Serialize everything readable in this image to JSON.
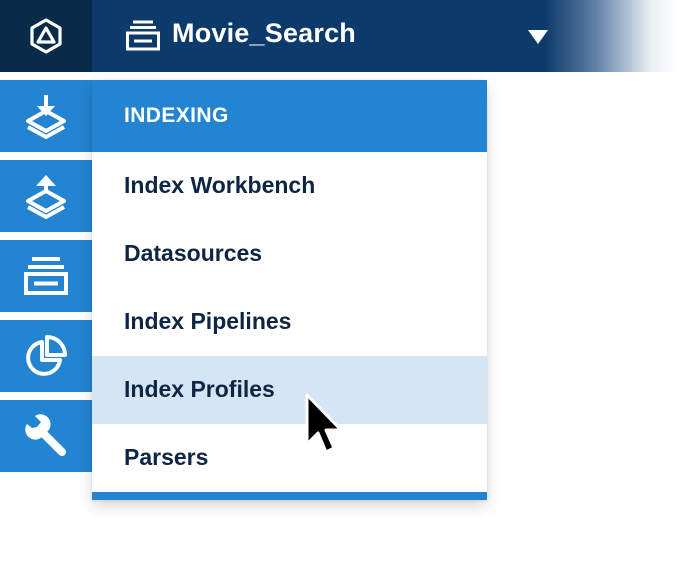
{
  "header": {
    "logo_icon": "fusion-logo-icon",
    "app_icon": "collection-stack-icon",
    "app_title": "Movie_Search",
    "dropdown_icon": "caret-down-icon",
    "bar_color": "#0c3a6b",
    "logo_bg": "#0a2a4a"
  },
  "sidebar": {
    "color": "#2384d1",
    "items": [
      {
        "icon": "indexing-download-icon"
      },
      {
        "icon": "querying-upload-icon"
      },
      {
        "icon": "collections-icon"
      },
      {
        "icon": "analytics-pie-icon"
      },
      {
        "icon": "wrench-icon"
      }
    ]
  },
  "menu": {
    "header": "INDEXING",
    "items": [
      {
        "label": "Index Workbench"
      },
      {
        "label": "Datasources"
      },
      {
        "label": "Index Pipelines"
      },
      {
        "label": "Index Profiles"
      },
      {
        "label": "Parsers"
      }
    ],
    "hovered_item": "Index Profiles",
    "hover_color": "#d4e5f5",
    "text_color": "#0f2544"
  },
  "cursor_icon": "mouse-pointer-icon"
}
